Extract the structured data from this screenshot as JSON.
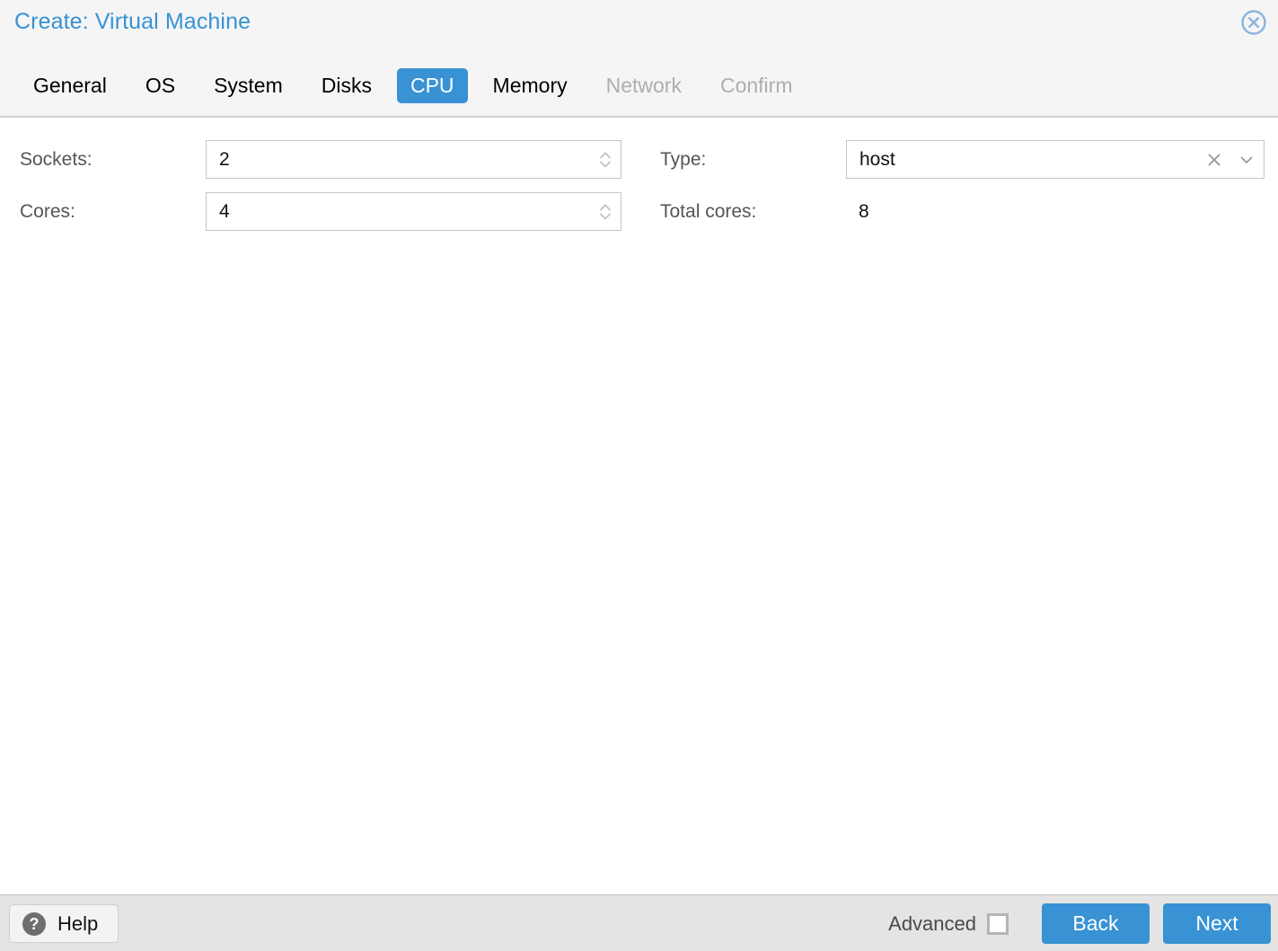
{
  "window": {
    "title": "Create: Virtual Machine",
    "close_icon": "close-circle-icon"
  },
  "tabs": [
    {
      "label": "General",
      "state": "enabled"
    },
    {
      "label": "OS",
      "state": "enabled"
    },
    {
      "label": "System",
      "state": "enabled"
    },
    {
      "label": "Disks",
      "state": "enabled"
    },
    {
      "label": "CPU",
      "state": "active"
    },
    {
      "label": "Memory",
      "state": "enabled"
    },
    {
      "label": "Network",
      "state": "disabled"
    },
    {
      "label": "Confirm",
      "state": "disabled"
    }
  ],
  "form": {
    "left": {
      "sockets": {
        "label": "Sockets:",
        "value": "2",
        "spinner_icon": "spinner-arrows-icon"
      },
      "cores": {
        "label": "Cores:",
        "value": "4",
        "spinner_icon": "spinner-arrows-icon"
      }
    },
    "right": {
      "type": {
        "label": "Type:",
        "value": "host",
        "clear_icon": "clear-x-icon",
        "trigger_icon": "chevron-down-icon"
      },
      "total_cores": {
        "label": "Total cores:",
        "value": "8"
      }
    }
  },
  "footer": {
    "help_label": "Help",
    "help_icon": "question-mark-icon",
    "advanced_label": "Advanced",
    "advanced_checked": false,
    "back_label": "Back",
    "next_label": "Next"
  },
  "colors": {
    "accent": "#3892d4",
    "header_bg": "#f5f5f5",
    "footer_bg": "#e4e4e4",
    "label_text": "#555555",
    "disabled_text": "#aeaeae"
  }
}
